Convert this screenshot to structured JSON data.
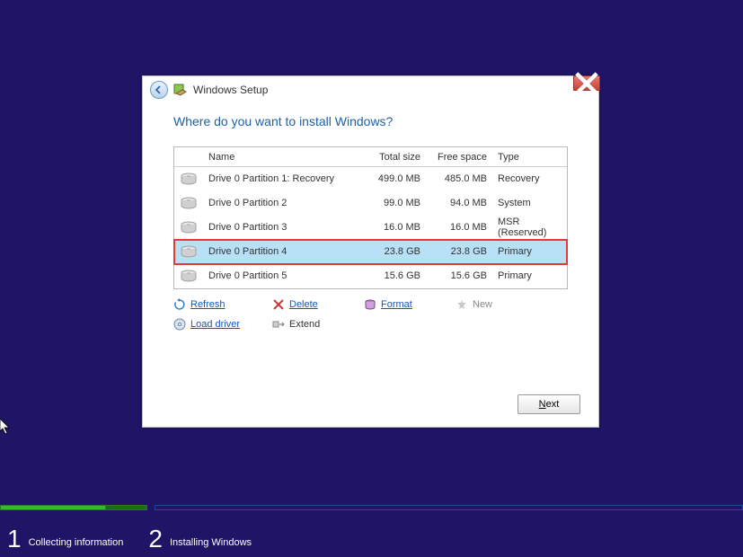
{
  "titlebar": {
    "title": "Windows Setup"
  },
  "heading": "Where do you want to install Windows?",
  "columns": {
    "name": "Name",
    "total": "Total size",
    "free": "Free space",
    "type": "Type"
  },
  "rows": [
    {
      "name": "Drive 0 Partition 1: Recovery",
      "total": "499.0 MB",
      "free": "485.0 MB",
      "type": "Recovery",
      "selected": false
    },
    {
      "name": "Drive 0 Partition 2",
      "total": "99.0 MB",
      "free": "94.0 MB",
      "type": "System",
      "selected": false
    },
    {
      "name": "Drive 0 Partition 3",
      "total": "16.0 MB",
      "free": "16.0 MB",
      "type": "MSR (Reserved)",
      "selected": false
    },
    {
      "name": "Drive 0 Partition 4",
      "total": "23.8 GB",
      "free": "23.8 GB",
      "type": "Primary",
      "selected": true
    },
    {
      "name": "Drive 0 Partition 5",
      "total": "15.6 GB",
      "free": "15.6 GB",
      "type": "Primary",
      "selected": false
    }
  ],
  "tools": {
    "refresh": "Refresh",
    "delete": "Delete",
    "format": "Format",
    "new": "New",
    "load_driver": "Load driver",
    "extend": "Extend"
  },
  "next_label": "Next",
  "steps": {
    "s1_num": "1",
    "s1_label": "Collecting information",
    "s2_num": "2",
    "s2_label": "Installing Windows"
  }
}
